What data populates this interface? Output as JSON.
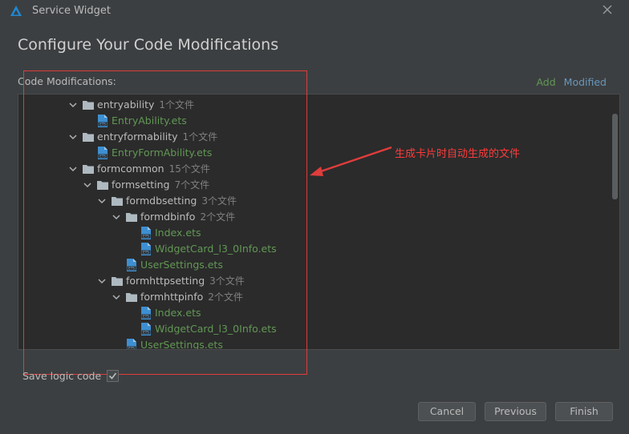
{
  "window": {
    "title": "Service Widget"
  },
  "heading": "Configure Your Code Modifications",
  "section_label": "Code Modifications:",
  "legend": {
    "add": "Add",
    "modified": "Modified"
  },
  "tree": [
    {
      "kind": "dir",
      "name": "entryability",
      "count": "1个文件",
      "indent": 0
    },
    {
      "kind": "file",
      "name": "EntryAbility.ets",
      "indent": 1
    },
    {
      "kind": "dir",
      "name": "entryformability",
      "count": "1个文件",
      "indent": 0
    },
    {
      "kind": "file",
      "name": "EntryFormAbility.ets",
      "indent": 1
    },
    {
      "kind": "dir",
      "name": "formcommon",
      "count": "15个文件",
      "indent": 0
    },
    {
      "kind": "dir",
      "name": "formsetting",
      "count": "7个文件",
      "indent": 1
    },
    {
      "kind": "dir",
      "name": "formdbsetting",
      "count": "3个文件",
      "indent": 2
    },
    {
      "kind": "dir",
      "name": "formdbinfo",
      "count": "2个文件",
      "indent": 3
    },
    {
      "kind": "file",
      "name": "Index.ets",
      "indent": 4
    },
    {
      "kind": "file",
      "name": "WidgetCard_l3_0Info.ets",
      "indent": 4
    },
    {
      "kind": "file",
      "name": "UserSettings.ets",
      "indent": 3
    },
    {
      "kind": "dir",
      "name": "formhttpsetting",
      "count": "3个文件",
      "indent": 2
    },
    {
      "kind": "dir",
      "name": "formhttpinfo",
      "count": "2个文件",
      "indent": 3
    },
    {
      "kind": "file",
      "name": "Index.ets",
      "indent": 4
    },
    {
      "kind": "file",
      "name": "WidgetCard_l3_0Info.ets",
      "indent": 4
    },
    {
      "kind": "file",
      "name": "UserSettings.ets",
      "indent": 3
    }
  ],
  "annotation": {
    "text": "生成卡片时自动生成的文件",
    "color": "#ff3b3b"
  },
  "save_logic": {
    "label": "Save logic code",
    "checked": true
  },
  "buttons": {
    "cancel": "Cancel",
    "previous": "Previous",
    "finish": "Finish"
  },
  "colors": {
    "add": "#629755",
    "modified": "#6897bb",
    "background": "#3c3f41",
    "panel": "#2b2b2b"
  },
  "icons": {
    "chevron": "chevron-down-icon",
    "folder": "folder-icon",
    "file": "ets-file-icon",
    "close": "close-icon",
    "logo": "app-logo-icon"
  }
}
